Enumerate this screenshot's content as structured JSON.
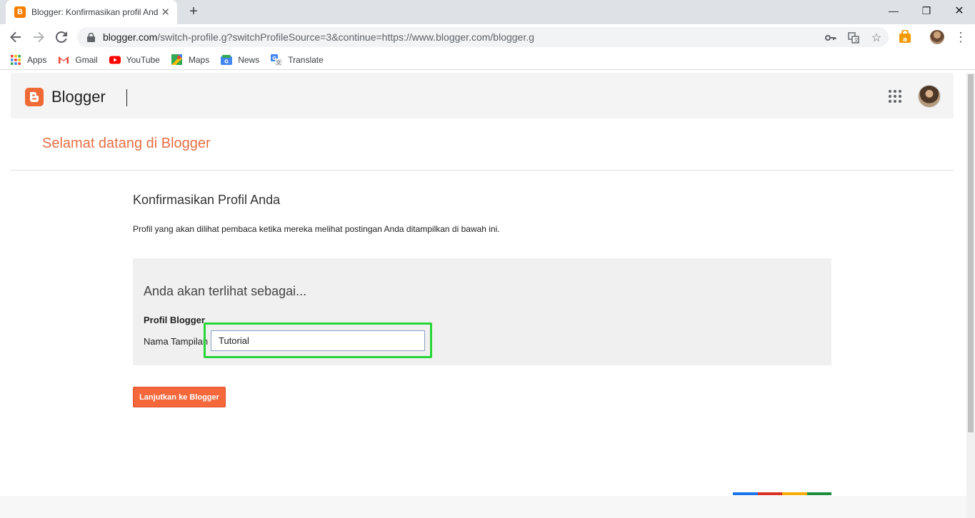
{
  "browser": {
    "tab_title": "Blogger: Konfirmasikan profil Anda",
    "tab_favicon": "B",
    "new_tab": "+",
    "url_host": "blogger.com",
    "url_path": "/switch-profile.g?switchProfileSource=3&continue=https://www.blogger.com/blogger.g",
    "bookmarks": [
      "Apps",
      "Gmail",
      "YouTube",
      "Maps",
      "News",
      "Translate"
    ]
  },
  "header": {
    "brand": "Blogger"
  },
  "page": {
    "welcome": "Selamat datang di Blogger",
    "confirm_title": "Konfirmasikan Profil Anda",
    "confirm_desc": "Profil yang akan dilihat pembaca ketika mereka melihat postingan Anda ditampilkan di bawah ini.",
    "seen_as": "Anda akan terlihat sebagai...",
    "profile_label": "Profil Blogger",
    "name_label": "Nama Tampilan",
    "name_value": "Tutorial",
    "continue_button": "Lanjutkan ke Blogger"
  },
  "colors": {
    "accent": "#f5683c",
    "welcome": "#e66f45",
    "highlight": "#29d63a",
    "google_bar": [
      "#1a73e8",
      "#d93025",
      "#f9ab00",
      "#1e8e3e"
    ]
  }
}
